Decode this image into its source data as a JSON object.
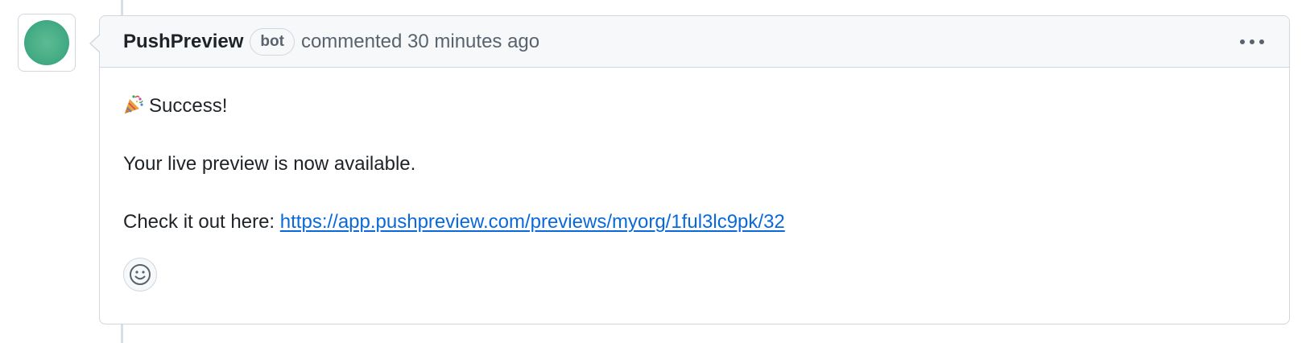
{
  "comment": {
    "author": "PushPreview",
    "badge": "bot",
    "meta": "commented 30 minutes ago",
    "body": {
      "heading_emoji": "party-popper-icon",
      "heading": "Success!",
      "line": "Your live preview is now available.",
      "link_prefix": "Check it out here:",
      "link_text": "https://app.pushpreview.com/previews/myorg/1ful3lc9pk/32"
    },
    "actions": {
      "more": "kebab-horizontal-icon",
      "reaction": "smiley-icon"
    }
  },
  "colors": {
    "link": "#0969da",
    "avatar": "#46ad86",
    "header_bg": "#f6f8fa",
    "border": "#d0d7de",
    "muted_text": "#59636e"
  }
}
